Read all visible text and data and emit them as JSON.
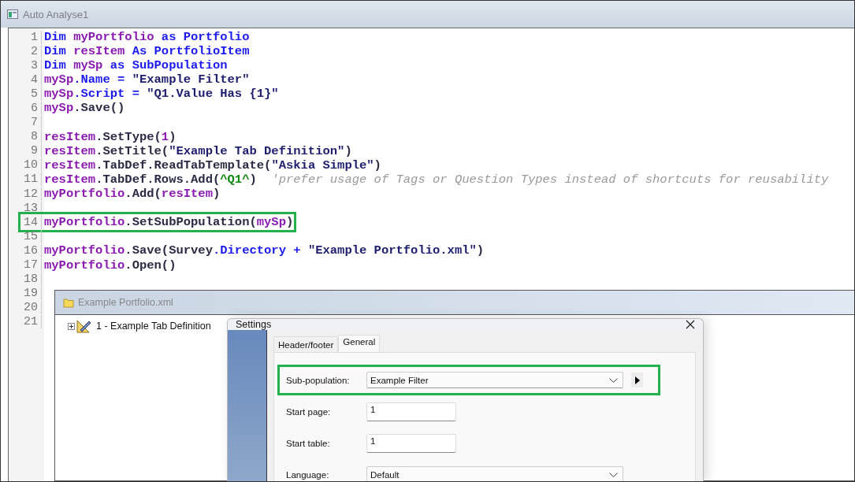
{
  "window": {
    "title": "Auto Analyse1"
  },
  "editor": {
    "lines": [
      {
        "number": "1",
        "highlighted": false,
        "tokens": [
          {
            "kind": "kw",
            "text": "Dim "
          },
          {
            "kind": "var",
            "text": "myPortfolio"
          },
          {
            "kind": "kw",
            "text": " as Portfolio"
          }
        ]
      },
      {
        "number": "2",
        "highlighted": false,
        "tokens": [
          {
            "kind": "kw",
            "text": "Dim "
          },
          {
            "kind": "var",
            "text": "resItem"
          },
          {
            "kind": "kw",
            "text": " As PortfolioItem"
          }
        ]
      },
      {
        "number": "3",
        "highlighted": false,
        "tokens": [
          {
            "kind": "kw",
            "text": "Dim "
          },
          {
            "kind": "var",
            "text": "mySp"
          },
          {
            "kind": "kw",
            "text": " as SubPopulation"
          }
        ]
      },
      {
        "number": "4",
        "highlighted": false,
        "tokens": [
          {
            "kind": "var",
            "text": "mySp"
          },
          {
            "kind": "kw",
            "text": ".Name = "
          },
          {
            "kind": "string",
            "text": "\"Example Filter\""
          }
        ]
      },
      {
        "number": "5",
        "highlighted": false,
        "tokens": [
          {
            "kind": "var",
            "text": "mySp"
          },
          {
            "kind": "kw",
            "text": ".Script = "
          },
          {
            "kind": "string",
            "text": "\"Q1.Value Has {1}\""
          }
        ]
      },
      {
        "number": "6",
        "highlighted": false,
        "tokens": [
          {
            "kind": "var",
            "text": "mySp"
          },
          {
            "kind": "plain",
            "text": ".Save()"
          }
        ]
      },
      {
        "number": "7",
        "highlighted": false
      },
      {
        "number": "8",
        "highlighted": false,
        "tokens": [
          {
            "kind": "var",
            "text": "resItem"
          },
          {
            "kind": "plain",
            "text": ".SetType("
          },
          {
            "kind": "var",
            "text": "1"
          },
          {
            "kind": "plain",
            "text": ")"
          }
        ]
      },
      {
        "number": "9",
        "highlighted": false,
        "tokens": [
          {
            "kind": "var",
            "text": "resItem"
          },
          {
            "kind": "plain",
            "text": ".SetTitle("
          },
          {
            "kind": "string",
            "text": "\"Example Tab Definition\""
          },
          {
            "kind": "plain",
            "text": ")"
          }
        ]
      },
      {
        "number": "10",
        "highlighted": false,
        "tokens": [
          {
            "kind": "var",
            "text": "resItem"
          },
          {
            "kind": "plain",
            "text": ".TabDef.ReadTabTemplate("
          },
          {
            "kind": "string",
            "text": "\"Askia Simple\""
          },
          {
            "kind": "plain",
            "text": ")"
          }
        ]
      },
      {
        "number": "11",
        "highlighted": false,
        "tokens": [
          {
            "kind": "var",
            "text": "resItem"
          },
          {
            "kind": "plain",
            "text": ".TabDef.Rows.Add("
          },
          {
            "kind": "shortcut",
            "text": "^Q1^"
          },
          {
            "kind": "plain",
            "text": ")  "
          },
          {
            "kind": "comment",
            "text": "'prefer usage of Tags or Question Types instead of shortcuts for reusability"
          }
        ]
      },
      {
        "number": "12",
        "highlighted": false,
        "tokens": [
          {
            "kind": "var",
            "text": "myPortfolio"
          },
          {
            "kind": "plain",
            "text": ".Add("
          },
          {
            "kind": "var",
            "text": "resItem"
          },
          {
            "kind": "plain",
            "text": ")"
          }
        ]
      },
      {
        "number": "13",
        "highlighted": false
      },
      {
        "number": "14",
        "highlighted": true,
        "tokens": [
          {
            "kind": "var",
            "text": "myPortfolio"
          },
          {
            "kind": "plain",
            "text": ".SetSubPopulation("
          },
          {
            "kind": "var",
            "text": "mySp"
          },
          {
            "kind": "plain",
            "text": ")"
          }
        ]
      },
      {
        "number": "15",
        "highlighted": false
      },
      {
        "number": "16",
        "highlighted": false,
        "tokens": [
          {
            "kind": "var",
            "text": "myPortfolio"
          },
          {
            "kind": "plain",
            "text": ".Save(Survey"
          },
          {
            "kind": "kw",
            "text": ".Directory + "
          },
          {
            "kind": "string",
            "text": "\"Example Portfolio.xml\""
          },
          {
            "kind": "plain",
            "text": ")"
          }
        ]
      },
      {
        "number": "17",
        "highlighted": false,
        "tokens": [
          {
            "kind": "var",
            "text": "myPortfolio"
          },
          {
            "kind": "plain",
            "text": ".Open()"
          }
        ]
      },
      {
        "number": "18",
        "highlighted": false
      },
      {
        "number": "19",
        "highlighted": false
      },
      {
        "number": "20",
        "highlighted": false
      },
      {
        "number": "21",
        "highlighted": false
      }
    ]
  },
  "portfolio_window": {
    "title": "Example Portfolio.xml",
    "tree": [
      {
        "label": "1 - Example Tab Definition",
        "expanded": false
      }
    ]
  },
  "settings_dialog": {
    "title": "Settings",
    "tabs": [
      {
        "label": "Header/footer",
        "selected": false
      },
      {
        "label": "General",
        "selected": true
      }
    ],
    "fields": [
      {
        "kind": "picker",
        "label": "Sub-population:",
        "value": "Example Filter",
        "highlighted": true
      },
      {
        "kind": "text",
        "label": "Start page:",
        "value": "1",
        "highlighted": false
      },
      {
        "kind": "text",
        "label": "Start table:",
        "value": "1",
        "highlighted": false
      },
      {
        "kind": "dropdown",
        "label": "Language:",
        "value": "Default",
        "highlighted": false
      }
    ]
  }
}
